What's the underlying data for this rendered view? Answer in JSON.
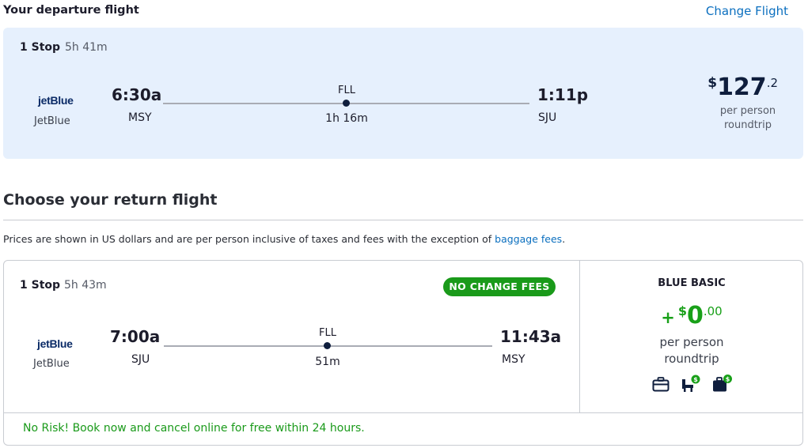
{
  "departure": {
    "section_title": "Your departure flight",
    "change_link": "Change Flight",
    "stops": "1 Stop",
    "total_duration": "5h 41m",
    "airline_logo": "jetBlue",
    "airline_name": "JetBlue",
    "depart_time": "6:30a",
    "depart_code": "MSY",
    "via": "FLL",
    "layover_duration": "1h 16m",
    "arrive_time": "1:11p",
    "arrive_code": "SJU",
    "price": {
      "currency": "$",
      "amount": "127",
      "cents": ".2",
      "per_line1": "per person",
      "per_line2": "roundtrip"
    }
  },
  "return_section": {
    "title": "Choose your return flight",
    "notice": "Prices are shown in US dollars and are per person inclusive of taxes and fees with the exception of",
    "notice_link": "baggage fees",
    "notice_end": "."
  },
  "return_flight": {
    "stops": "1 Stop",
    "total_duration": "5h 43m",
    "badge": "NO CHANGE FEES",
    "airline_logo": "jetBlue",
    "airline_name": "JetBlue",
    "depart_time": "7:00a",
    "depart_code": "SJU",
    "via": "FLL",
    "layover_duration": "51m",
    "arrive_time": "11:43a",
    "arrive_code": "MSY",
    "fare": {
      "name": "BLUE BASIC",
      "plus": "+",
      "currency": "$",
      "amount": "0",
      "cents": ".00",
      "per_line1": "per person",
      "per_line2": "roundtrip",
      "amenity_icons": [
        "carry-on-bag-icon",
        "seat-fee-icon",
        "checked-bag-fee-icon"
      ]
    },
    "no_risk": "No Risk! Book now and cancel online for free within 24 hours."
  },
  "colors": {
    "accent_link": "#0b6fbf",
    "card_bg": "#e6f0fd",
    "green": "#1a9a1a",
    "navy": "#0f1e3d"
  }
}
